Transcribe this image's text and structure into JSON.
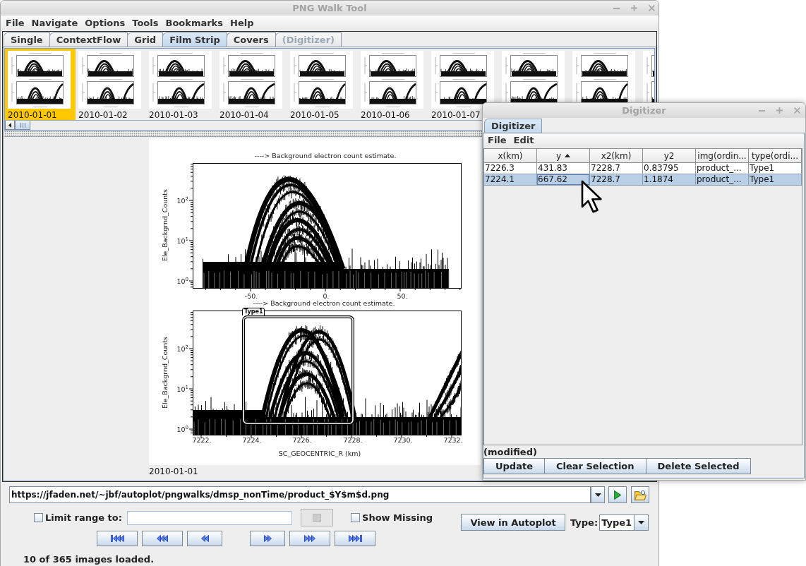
{
  "main_window": {
    "title": "PNG Walk Tool",
    "menu": [
      "File",
      "Navigate",
      "Options",
      "Tools",
      "Bookmarks",
      "Help"
    ],
    "tabs": [
      {
        "label": "Single",
        "selected": false,
        "disabled": false
      },
      {
        "label": "ContextFlow",
        "selected": false,
        "disabled": false
      },
      {
        "label": "Grid",
        "selected": false,
        "disabled": false
      },
      {
        "label": "Film Strip",
        "selected": true,
        "disabled": false
      },
      {
        "label": "Covers",
        "selected": false,
        "disabled": false
      },
      {
        "label": "(Digitizer)",
        "selected": false,
        "disabled": true
      }
    ],
    "film_strip": [
      {
        "label": "2010-01-01",
        "selected": true
      },
      {
        "label": "2010-01-02",
        "selected": false
      },
      {
        "label": "2010-01-03",
        "selected": false
      },
      {
        "label": "2010-01-04",
        "selected": false
      },
      {
        "label": "2010-01-05",
        "selected": false
      },
      {
        "label": "2010-01-06",
        "selected": false
      },
      {
        "label": "2010-01-07",
        "selected": false
      },
      {
        "selected": false
      },
      {
        "selected": false
      },
      {
        "selected": false
      }
    ],
    "image": {
      "plots": [
        {
          "title": "----> Background electron count estimate.",
          "ylabel": "Ele_Backgrnd_Counts",
          "yticks": [
            "10$^{2}$",
            "10$^{1}$",
            "10$^{0}$"
          ],
          "xticks": [
            "-50.",
            "0.",
            "50."
          ]
        },
        {
          "title": "----> Background electron count estimate.",
          "ylabel": "Ele_Backgrnd_Counts",
          "yticks": [
            "10$^{2}$",
            "10$^{1}$",
            "10$^{0}$"
          ],
          "xticks": [
            "7222.",
            "7224.",
            "7226.",
            "7228.",
            "7230.",
            "7232."
          ],
          "xlabel": "SC_GEOCENTRIC_R (km)",
          "selection": {
            "label": "Type1"
          }
        }
      ],
      "caption": "2010-01-01"
    },
    "url_field": {
      "value": "https://jfaden.net/~jbf/autoplot/pngwalks/dmsp_nonTime/product_$Y$m$d.png"
    },
    "limit_range": {
      "label": "Limit range to:",
      "checked": false
    },
    "range_button": {
      "disabled": true
    },
    "show_missing": {
      "label": "Show Missing",
      "checked": false
    },
    "view_button": {
      "label": "View in Autoplot"
    },
    "type_selector": {
      "label": "Type:",
      "value": "Type1"
    },
    "status": "10 of 365 images loaded."
  },
  "digitizer_window": {
    "title": "Digitizer",
    "tabs": [
      {
        "label": "Digitizer",
        "selected": true
      }
    ],
    "menu": [
      "File",
      "Edit"
    ],
    "table": {
      "columns": [
        {
          "label": "x(km)",
          "sorted": false
        },
        {
          "label": "y",
          "sorted": true
        },
        {
          "label": "x2(km)",
          "sorted": false
        },
        {
          "label": "y2",
          "sorted": false
        },
        {
          "label": "img(ordin...",
          "sorted": false
        },
        {
          "label": "type(ordi...",
          "sorted": false
        }
      ],
      "rows": [
        {
          "selected": false,
          "cells": [
            {
              "text": "7226.3",
              "focused": false
            },
            {
              "text": "431.83",
              "focused": false
            },
            {
              "text": "7228.7",
              "focused": false
            },
            {
              "text": "0.83795",
              "focused": false
            },
            {
              "text": "product_...",
              "focused": false
            },
            {
              "text": "Type1",
              "focused": false
            }
          ]
        },
        {
          "selected": true,
          "cells": [
            {
              "text": "7224.1",
              "focused": false
            },
            {
              "text": "667.62",
              "focused": true
            },
            {
              "text": "7228.7",
              "focused": false
            },
            {
              "text": "1.1874",
              "focused": false
            },
            {
              "text": "product_...",
              "focused": false
            },
            {
              "text": "Type1",
              "focused": false
            }
          ]
        }
      ]
    },
    "status": "(modified)",
    "buttons": [
      "Update",
      "Clear Selection",
      "Delete Selected"
    ]
  }
}
